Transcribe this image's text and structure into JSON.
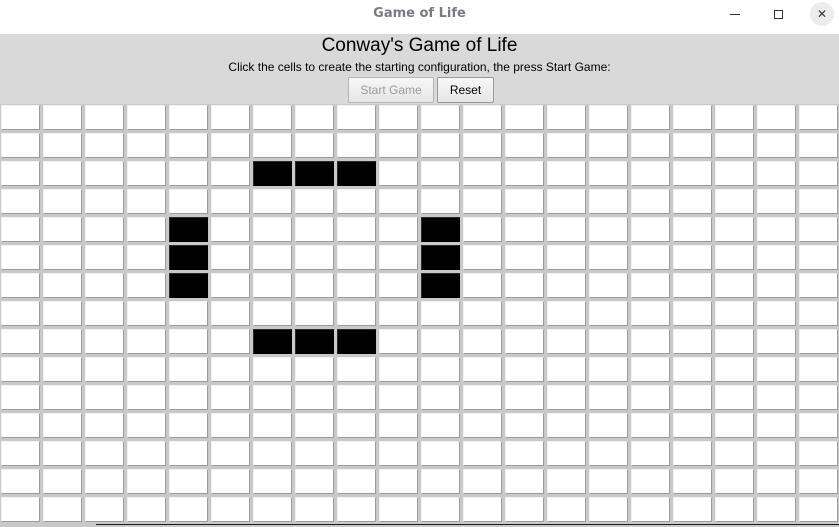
{
  "window": {
    "title": "Game of Life",
    "minimize_icon": "minimize-icon",
    "maximize_icon": "maximize-icon",
    "close_icon": "close-icon",
    "close_glyph": "✕"
  },
  "header": {
    "heading": "Conway's Game of Life",
    "instructions": "Click the cells to create the starting configuration, the press Start Game:",
    "start_label": "Start Game",
    "reset_label": "Reset"
  },
  "grid": {
    "columns": 20,
    "rows": 15,
    "alive_cells": [
      [
        2,
        6
      ],
      [
        2,
        7
      ],
      [
        2,
        8
      ],
      [
        4,
        4
      ],
      [
        5,
        4
      ],
      [
        6,
        4
      ],
      [
        4,
        10
      ],
      [
        5,
        10
      ],
      [
        6,
        10
      ],
      [
        8,
        6
      ],
      [
        8,
        7
      ],
      [
        8,
        8
      ]
    ],
    "colors": {
      "alive": "#000000",
      "dead": "#ffffff",
      "header_bg": "#d9d9d9"
    }
  }
}
